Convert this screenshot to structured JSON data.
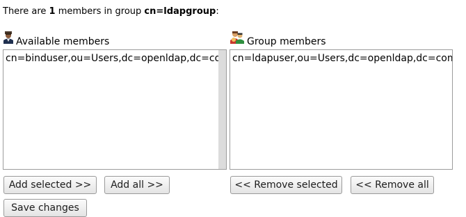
{
  "summary": {
    "prefix": "There are ",
    "count": "1",
    "middle": " members in group ",
    "group": "cn=ldapgroup",
    "suffix": ":"
  },
  "available": {
    "title": "Available members",
    "icon": "user-icon",
    "options": [
      "cn=binduser,ou=Users,dc=openldap,dc=com"
    ]
  },
  "group_members": {
    "title": "Group members",
    "icon": "group-icon",
    "options": [
      "cn=ldapuser,ou=Users,dc=openldap,dc=com"
    ]
  },
  "buttons": {
    "add_selected": "Add selected >>",
    "add_all": "Add all >>",
    "remove_selected": "<< Remove selected",
    "remove_all": "<< Remove all",
    "save": "Save changes"
  }
}
